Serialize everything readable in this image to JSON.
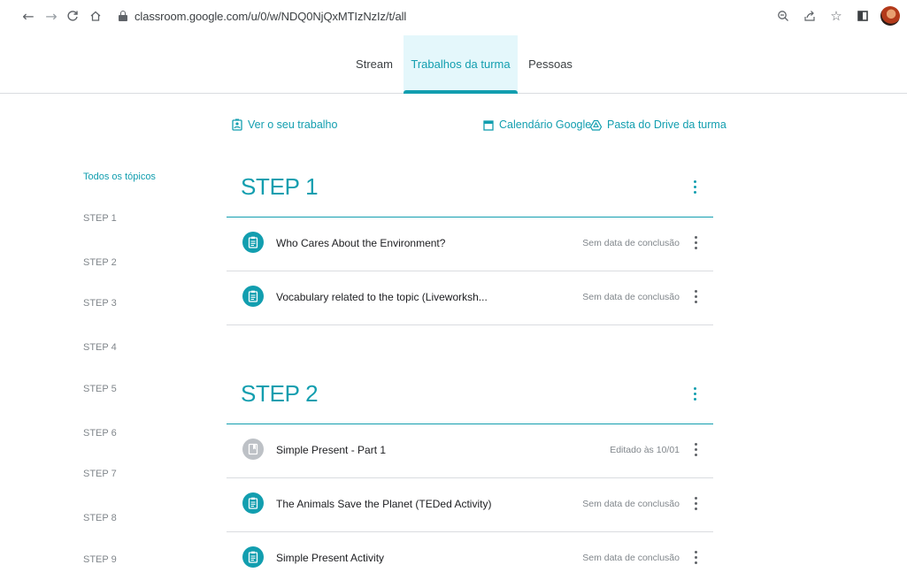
{
  "browser": {
    "url": "classroom.google.com/u/0/w/NDQ0NjQxMTIzNzIz/t/all",
    "icons": [
      "back-arrow-icon",
      "forward-arrow-icon",
      "reload-icon",
      "home-icon",
      "lock-icon",
      "zoom-icon",
      "share-icon",
      "star-icon",
      "sidebar-icon",
      "profile-avatar"
    ]
  },
  "tabs": [
    {
      "label": "Stream",
      "active": false
    },
    {
      "label": "Trabalhos da turma",
      "active": true
    },
    {
      "label": "Pessoas",
      "active": false
    }
  ],
  "actions": {
    "view_work": "Ver o seu trabalho",
    "calendar": "Calendário Google",
    "drive": "Pasta do Drive da turma"
  },
  "topics": {
    "all": "Todos os tópicos",
    "items": [
      "STEP 1",
      "STEP 2",
      "STEP 3",
      "STEP 4",
      "STEP 5",
      "STEP 6",
      "STEP 7",
      "STEP 8",
      "STEP 9"
    ]
  },
  "sections": [
    {
      "title": "STEP 1",
      "items": [
        {
          "title": "Who Cares About the Environment?",
          "meta": "Sem data de conclusão",
          "icon": "assignment-icon",
          "draft": false
        },
        {
          "title": "Vocabulary related to the topic (Liveworksh...",
          "meta": "Sem data de conclusão",
          "icon": "assignment-icon",
          "draft": false
        }
      ]
    },
    {
      "title": "STEP 2",
      "items": [
        {
          "title": "Simple Present - Part 1",
          "meta": "Editado às 10/01",
          "icon": "material-icon",
          "draft": true
        },
        {
          "title": "The Animals Save the Planet (TEDed Activity)",
          "meta": "Sem data de conclusão",
          "icon": "assignment-icon",
          "draft": false
        },
        {
          "title": "Simple Present Activity",
          "meta": "Sem data de conclusão",
          "icon": "assignment-icon",
          "draft": false
        }
      ]
    }
  ],
  "colors": {
    "accent": "#129eaf",
    "active_tab_bg": "#e4f7fb",
    "draft_icon": "#bdc1c6",
    "divider": "#dadce0"
  }
}
